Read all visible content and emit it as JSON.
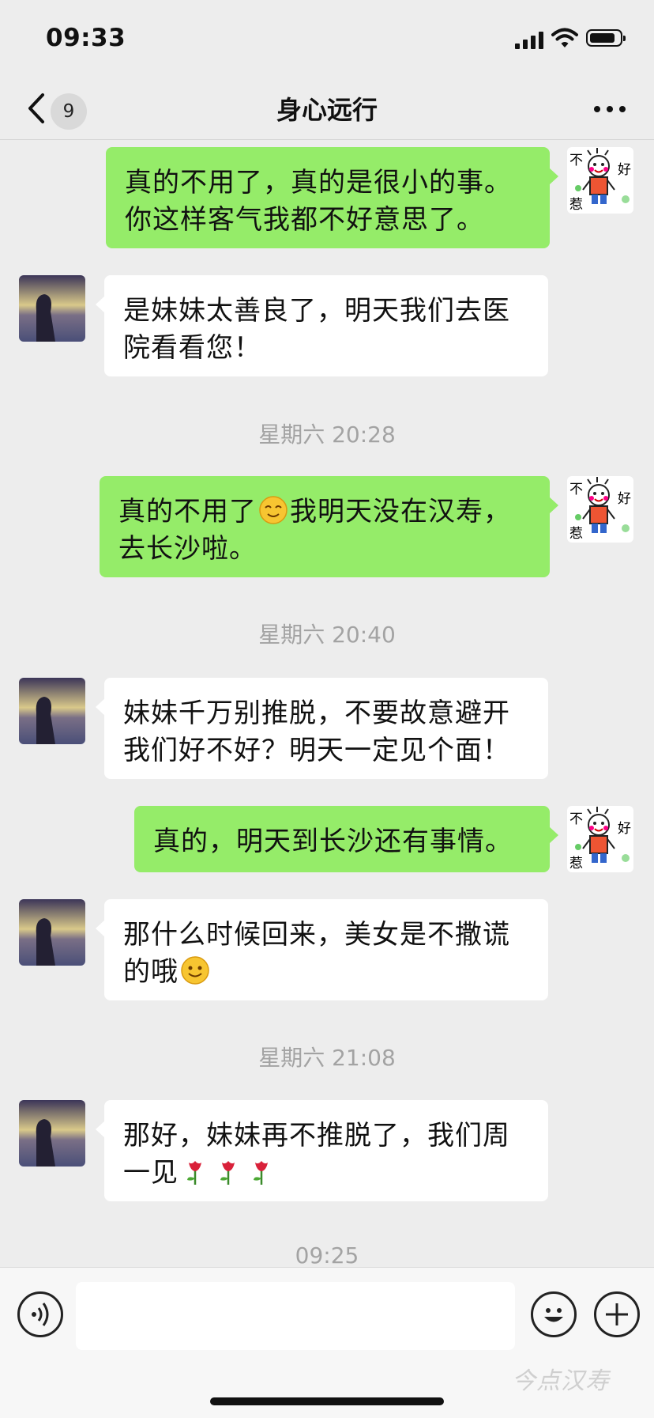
{
  "status_bar": {
    "time": "09:33",
    "battery_level": 0.85
  },
  "nav": {
    "unread_count": "9",
    "title": "身心远行",
    "back_icon": "chevron-left-icon",
    "more_icon": "more-dots-icon"
  },
  "messages": [
    {
      "type": "out",
      "text_lines": [
        "真的不用了，真的是很小的事。",
        "你这样客气我都不好意思了。"
      ]
    },
    {
      "type": "in",
      "text_lines": [
        "是妹妹太善良了，明天我们去医",
        "院看看您！"
      ]
    },
    {
      "type": "time",
      "text": "星期六 20:28"
    },
    {
      "type": "out",
      "text_before": "真的不用了",
      "emoji": "smile-closed-eyes-emoji",
      "text_after": "我明天没在汉寿，",
      "text_line2": "去长沙啦。"
    },
    {
      "type": "time",
      "text": "星期六 20:40"
    },
    {
      "type": "in",
      "text_lines": [
        "妹妹千万别推脱，不要故意避开",
        "我们好不好？明天一定见个面！"
      ]
    },
    {
      "type": "out",
      "text_lines": [
        "真的，明天到长沙还有事情。"
      ]
    },
    {
      "type": "in",
      "text_line1": "那什么时候回来，美女是不撒谎",
      "text_line2": "的哦",
      "emoji": "smile-emoji"
    },
    {
      "type": "time",
      "text": "星期六 21:08"
    },
    {
      "type": "in",
      "text_line1": "那好，妹妹再不推脱了，我们周",
      "text_line2": "一见",
      "emoji": "rose-emoji"
    },
    {
      "type": "time",
      "text": "09:25"
    }
  ],
  "sticker_text": {
    "top_left": "不",
    "top_right": "好",
    "bottom_left": "惹"
  },
  "input": {
    "voice_icon": "voice-icon",
    "emoji_icon": "emoji-face-icon",
    "plus_icon": "plus-icon",
    "value": ""
  },
  "watermark": "今点汉寿",
  "colors": {
    "outgoing_bubble": "#95ec69",
    "incoming_bubble": "#ffffff",
    "background": "#ededed"
  }
}
